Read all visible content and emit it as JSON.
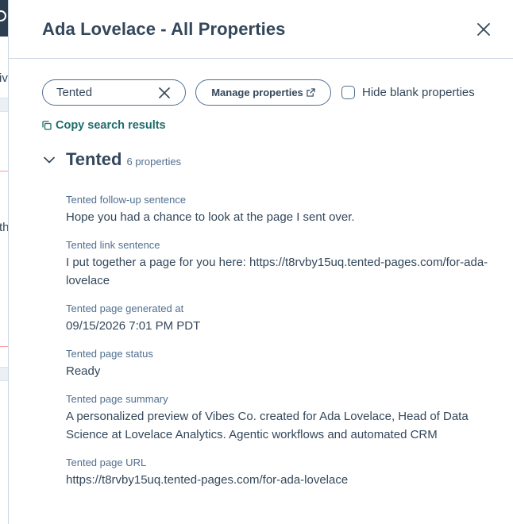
{
  "background": {
    "fragments": [
      "iv",
      "th"
    ]
  },
  "panel": {
    "title": "Ada Lovelace - All Properties",
    "search": {
      "value": "Tented",
      "placeholder": ""
    },
    "manage_label": "Manage properties",
    "hide_blank_label": "Hide blank properties",
    "copy_label": "Copy search results"
  },
  "section": {
    "title": "Tented",
    "count": "6 properties",
    "properties": [
      {
        "label": "Tented follow-up sentence",
        "value": "Hope you had a chance to look at the page I sent over."
      },
      {
        "label": "Tented link sentence",
        "value": "I put together a page for you here: https://t8rvby15uq.tented-pages.com/for-ada-lovelace"
      },
      {
        "label": "Tented page generated at",
        "value": "09/15/2026 7:01 PM PDT"
      },
      {
        "label": "Tented page status",
        "value": "Ready"
      },
      {
        "label": "Tented page summary",
        "value": "A personalized preview of Vibes Co. created for Ada Lovelace, Head of Data Science at Lovelace Analytics. Agentic workflows and automated CRM"
      },
      {
        "label": "Tented page URL",
        "value": "https://t8rvby15uq.tented-pages.com/for-ada-lovelace"
      }
    ]
  },
  "colors": {
    "text": "#33475b",
    "muted": "#516f90",
    "border": "#cbd6e2",
    "link": "#1f6b6b",
    "dark_nav": "#2d3e50"
  },
  "icons": [
    "close-icon",
    "clear-search-icon",
    "external-link-icon",
    "copy-icon",
    "chevron-down-icon"
  ]
}
